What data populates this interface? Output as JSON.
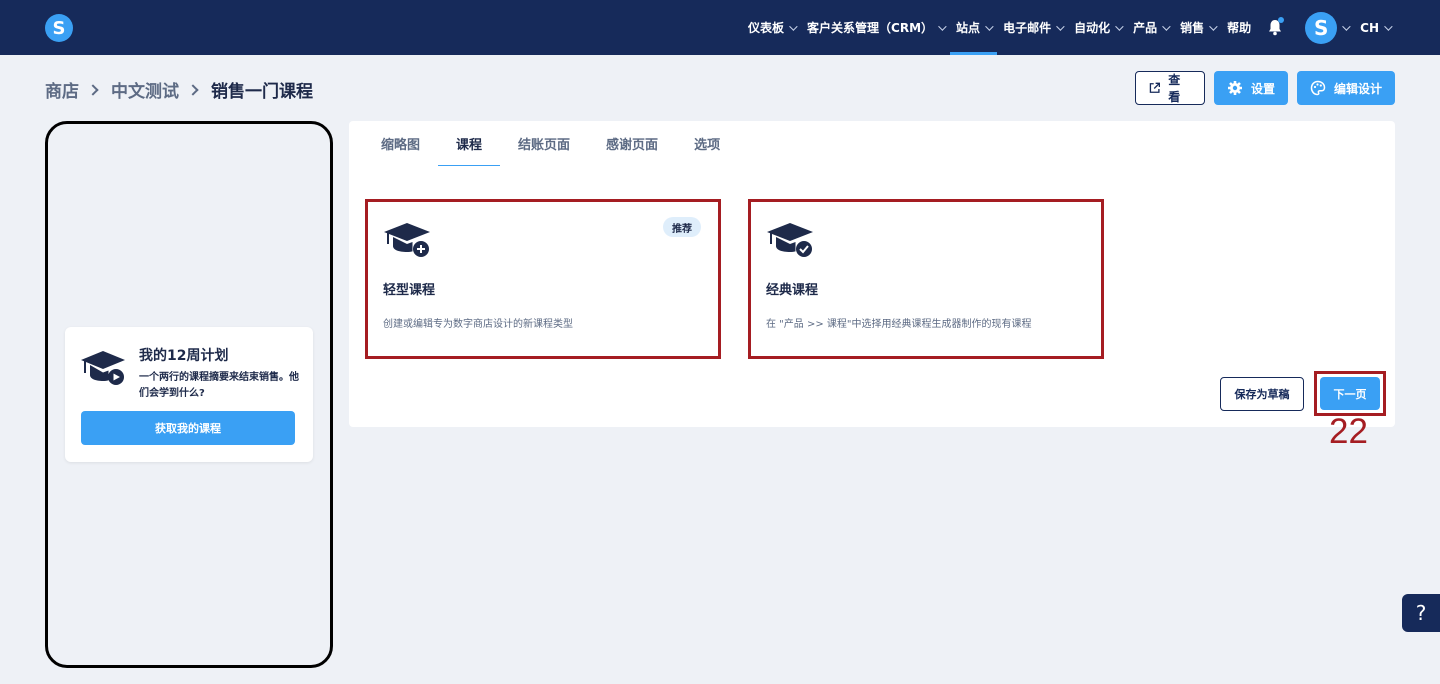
{
  "nav": {
    "logo": "S",
    "items": [
      {
        "label": "仪表板"
      },
      {
        "label": "客户关系管理（CRM）"
      },
      {
        "label": "站点"
      },
      {
        "label": "电子邮件"
      },
      {
        "label": "自动化"
      },
      {
        "label": "产品"
      },
      {
        "label": "销售"
      },
      {
        "label": "帮助"
      }
    ],
    "avatar": "S",
    "language": "CH"
  },
  "breadcrumb": [
    "商店",
    "中文测试",
    "销售一门课程"
  ],
  "actions": {
    "view": "查看",
    "settings": "设置",
    "edit_design": "编辑设计"
  },
  "preview": {
    "title": "我的12周计划",
    "description": "一个两行的课程摘要来结束销售。他们会学到什么?",
    "button": "获取我的课程"
  },
  "tabs": [
    "缩略图",
    "课程",
    "结账页面",
    "感谢页面",
    "选项"
  ],
  "cards": [
    {
      "title": "轻型课程",
      "description": "创建或编辑专为数字商店设计的新课程类型",
      "badge": "推荐"
    },
    {
      "title": "经典课程",
      "description": "在 \"产品 >> 课程\"中选择用经典课程生成器制作的现有课程"
    }
  ],
  "footer": {
    "save_draft": "保存为草稿",
    "next": "下一页"
  },
  "step_number": "22",
  "help": "?",
  "colors": {
    "nav_bg": "#162a5a",
    "accent": "#3aa0f4",
    "highlight": "#a51d22"
  }
}
